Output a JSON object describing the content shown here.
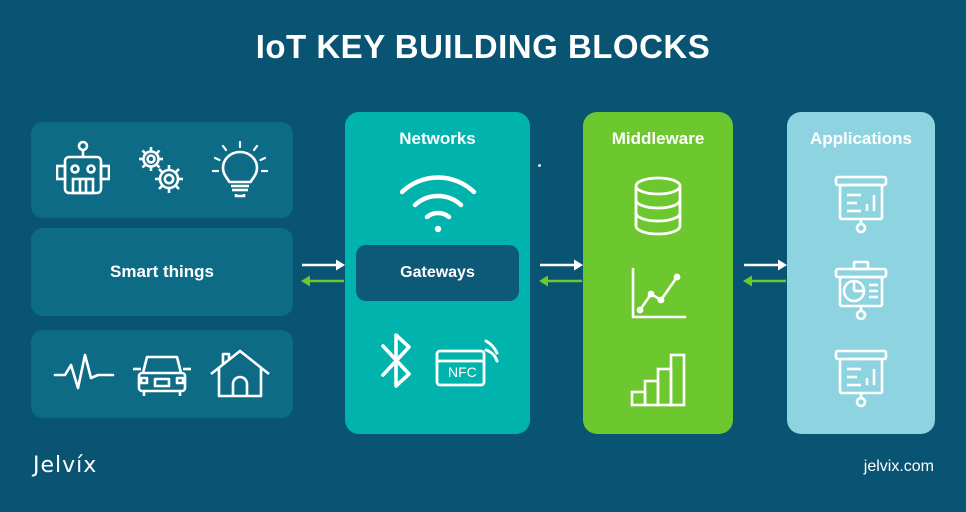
{
  "title": "IoT KEY BUILDING BLOCKS",
  "colors": {
    "background": "#0a5473",
    "card": "#0d6b86",
    "networks": "#00b3ad",
    "middleware": "#6dc72e",
    "applications": "#8ed3e0",
    "gateway_box": "#0c5a77",
    "arrow_forward": "#ffffff",
    "arrow_backward": "#6dc72e",
    "text": "#ffffff"
  },
  "left_column": {
    "top_card": {
      "icons": [
        "robot-icon",
        "gears-icon",
        "lightbulb-icon"
      ]
    },
    "middle_card": {
      "label": "Smart things"
    },
    "bottom_card": {
      "icons": [
        "pulse-icon",
        "car-icon",
        "house-icon"
      ]
    }
  },
  "panels": [
    {
      "id": "networks",
      "title": "Networks",
      "top_icon": "wifi-icon",
      "box_label": "Gateways",
      "bottom_icons": [
        "bluetooth-icon",
        "nfc-card-icon"
      ]
    },
    {
      "id": "middleware",
      "title": "Middleware",
      "icons": [
        "database-icon",
        "line-chart-icon",
        "bar-chart-icon"
      ]
    },
    {
      "id": "applications",
      "title": "Applications",
      "icons": [
        "presentation-bar-icon",
        "presentation-pie-icon",
        "presentation-chart-icon"
      ]
    }
  ],
  "arrows": [
    {
      "id": "arrows-things-networks",
      "forward": "arrow-right-icon",
      "backward": "arrow-left-icon"
    },
    {
      "id": "arrows-networks-middleware",
      "forward": "arrow-right-icon",
      "backward": "arrow-left-icon"
    },
    {
      "id": "arrows-middleware-applications",
      "forward": "arrow-right-icon",
      "backward": "arrow-left-icon"
    }
  ],
  "footer": {
    "logo": "Jelvíx",
    "website": "jelvix.com"
  }
}
